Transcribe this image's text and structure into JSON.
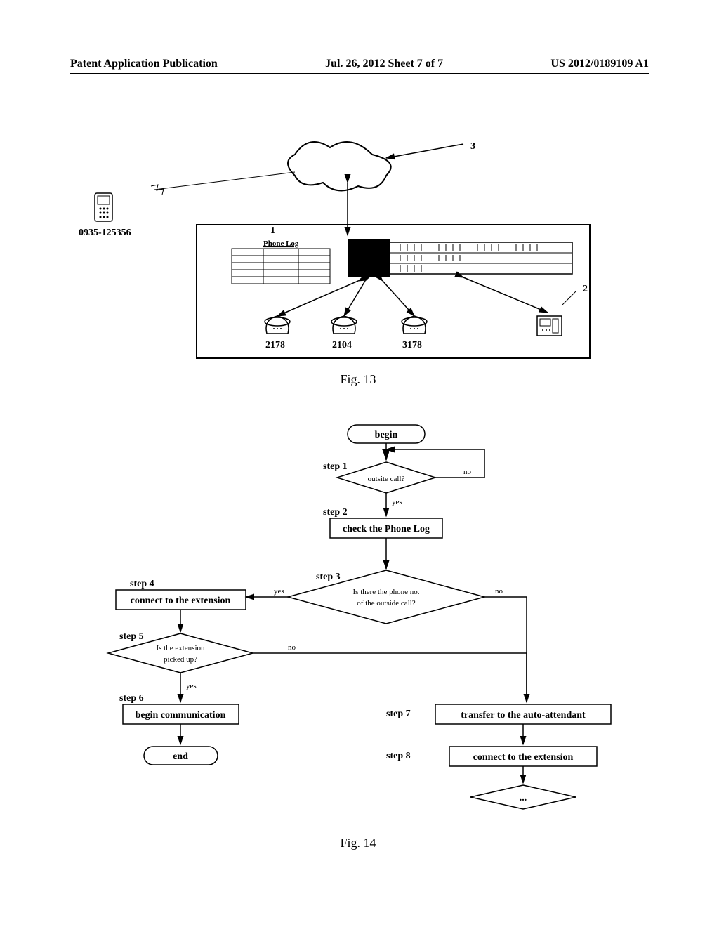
{
  "header": {
    "left": "Patent Application Publication",
    "center": "Jul. 26, 2012  Sheet 7 of 7",
    "right": "US 2012/0189109 A1"
  },
  "fig13": {
    "caption": "Fig.  13",
    "labels": {
      "cloud": "3",
      "pbx": "1",
      "ext_device": "2",
      "mobile_number": "0935-125356",
      "phone_log": "Phone Log",
      "ext1": "2178",
      "ext2": "2104",
      "ext3": "3178"
    }
  },
  "fig14": {
    "caption": "Fig.  14",
    "steps": {
      "begin": "begin",
      "s1_label": "step 1",
      "s1_text": "outsite call?",
      "s1_yes": "yes",
      "s1_no": "no",
      "s2_label": "step 2",
      "s2_text": "check the Phone Log",
      "s3_label": "step 3",
      "s3_text1": "Is there the phone no.",
      "s3_text2": "of the outside call?",
      "s3_yes": "yes",
      "s3_no": "no",
      "s4_label": "step 4",
      "s4_text": "connect to the extension",
      "s5_label": "step 5",
      "s5_text1": "Is the extension",
      "s5_text2": "picked up?",
      "s5_yes": "yes",
      "s5_no": "no",
      "s6_label": "step 6",
      "s6_text": "begin communication",
      "s7_label": "step 7",
      "s7_text": "transfer to the auto-attendant",
      "s8_label": "step 8",
      "s8_text": "connect to the extension",
      "end": "end",
      "ellipsis": "..."
    }
  }
}
